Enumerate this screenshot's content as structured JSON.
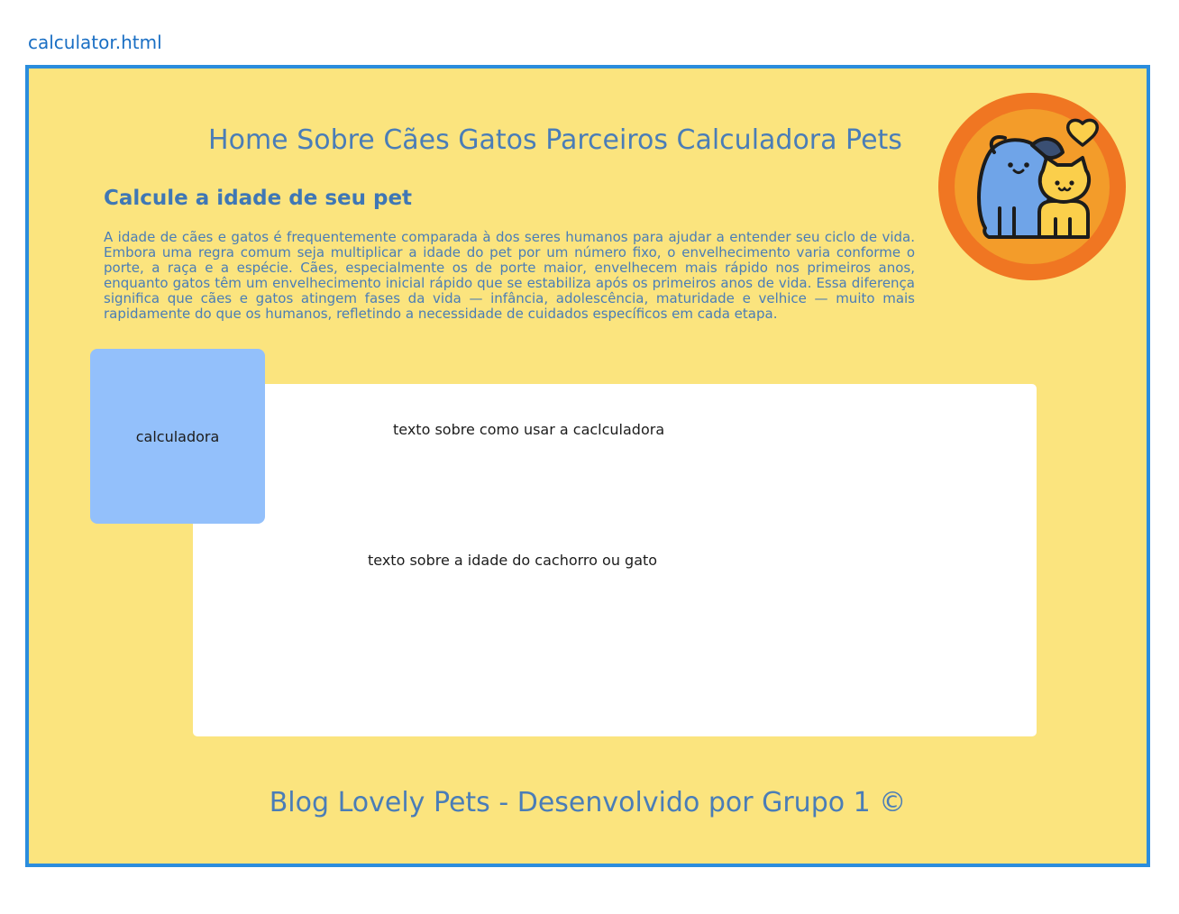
{
  "file_label": "calculator.html",
  "nav": {
    "items": [
      "Home",
      "Sobre",
      "Cães",
      "Gatos",
      "Parceiros",
      "Calculadora Pets"
    ]
  },
  "logo": {
    "icon": "dog-and-cat-with-heart-icon",
    "colors": {
      "outer": "#f07622",
      "inner": "#f39c2a",
      "dog": "#6fa4e8",
      "cat": "#fbcf4b",
      "heart": "#fbcf4b"
    }
  },
  "main": {
    "title": "Calcule a idade de seu pet",
    "intro": "A idade de cães e gatos é frequentemente comparada à dos seres humanos para ajudar a entender seu ciclo de vida. Embora uma regra comum seja multiplicar a idade do pet por um número fixo, o envelhecimento varia conforme o porte, a raça e a espécie. Cães, especialmente os de porte maior, envelhecem mais rápido nos primeiros anos, enquanto gatos têm um envelhecimento inicial rápido que se estabiliza após os primeiros anos de vida. Essa diferença significa que cães e gatos atingem fases da vida — infância, adolescência, maturidade e velhice — muito mais rapidamente do que os humanos, refletindo a necessidade de cuidados específicos em cada etapa.",
    "calculator_label": "calculadora",
    "usage_text": "texto sobre como usar a caclculadora",
    "age_text": "texto sobre a idade do cachorro ou gato"
  },
  "footer": {
    "text": "Blog Lovely Pets - Desenvolvido por Grupo 1 ©"
  },
  "colors": {
    "page_background": "#fbe47e",
    "frame_border": "#2b8ddd",
    "text_blue": "#4a7db7",
    "calculator_box": "#93c0fb"
  }
}
